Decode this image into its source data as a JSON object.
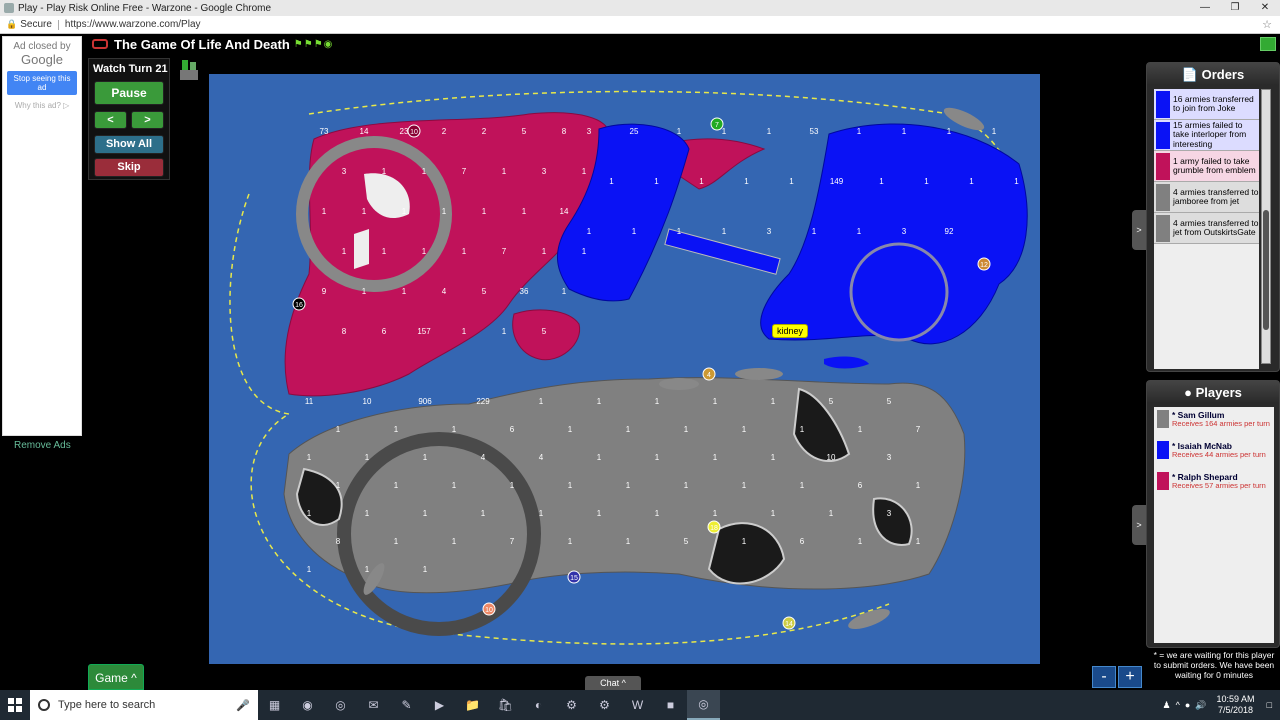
{
  "browser": {
    "tab_title": "Play - Play Risk Online Free - Warzone - Google Chrome",
    "secure_label": "Secure",
    "url": "https://www.warzone.com/Play"
  },
  "ad": {
    "closed_by": "Ad closed by",
    "google": "Google",
    "stop_seeing": "Stop seeing this ad",
    "why": "Why this ad? ▷",
    "remove_ads": "Remove Ads"
  },
  "game": {
    "title": "The Game Of Life And Death",
    "turn_label": "Watch Turn 21",
    "pause": "Pause",
    "prev": "<",
    "next": ">",
    "show_all": "Show All",
    "skip": "Skip",
    "game_menu": "Game ^",
    "chat": "Chat ^",
    "zoom_out": "-",
    "zoom_in": "+",
    "tooltip": "kidney"
  },
  "colors": {
    "sam": "#808080",
    "isaiah": "#0a12f5",
    "ralph": "#c0125a",
    "ocean": "#3466b2"
  },
  "orders": {
    "title": "Orders",
    "items": [
      {
        "text": "16 armies transferred to join from Joke",
        "color": "#0a12f5"
      },
      {
        "text": "15 armies failed to take interloper from interesting",
        "color": "#0a12f5"
      },
      {
        "text": "1 army failed to take grumble from emblem",
        "color": "#c0125a"
      },
      {
        "text": "4 armies transferred to jamboree from jet",
        "color": "#808080"
      },
      {
        "text": "4 armies transferred to jet from OutskirtsGate",
        "color": "#808080"
      }
    ]
  },
  "players": {
    "title": "Players",
    "list": [
      {
        "name": "* Sam Gillum",
        "income": "Receives 164 armies per turn",
        "color": "#808080"
      },
      {
        "name": "* Isaiah McNab",
        "income": "Receives 44 armies per turn",
        "color": "#0a12f5"
      },
      {
        "name": "* Ralph Shepard",
        "income": "Receives 57 armies per turn",
        "color": "#c0125a"
      }
    ]
  },
  "waiting_text": "* = we are waiting for this player to submit orders.  We have been waiting for 0 minutes",
  "taskbar": {
    "search_placeholder": "Type here to search",
    "time": "10:59 AM",
    "date": "7/5/2018"
  },
  "map_labels": {
    "magenta": [
      "73",
      "14",
      "23",
      "2",
      "2",
      "5",
      "8",
      "3",
      "1",
      "1",
      "7",
      "1",
      "3",
      "1",
      "1",
      "1",
      "1",
      "1",
      "1",
      "1",
      "14",
      "1",
      "1",
      "1",
      "1",
      "7",
      "1",
      "1",
      "9",
      "1",
      "1",
      "4",
      "5",
      "36",
      "1",
      "8",
      "6",
      "157",
      "1",
      "1",
      "5"
    ],
    "blue": [
      "3",
      "25",
      "1",
      "1",
      "1",
      "53",
      "1",
      "1",
      "1",
      "1",
      "1",
      "1",
      "1",
      "1",
      "1",
      "149",
      "1",
      "1",
      "1",
      "1",
      "1",
      "1",
      "1",
      "1",
      "3",
      "1",
      "1",
      "3",
      "92"
    ],
    "gray": [
      "11",
      "10",
      "906",
      "229",
      "1",
      "1",
      "1",
      "1",
      "1",
      "5",
      "5",
      "1",
      "1",
      "1",
      "6",
      "1",
      "1",
      "1",
      "1",
      "1",
      "1",
      "7",
      "1",
      "1",
      "1",
      "4",
      "4",
      "1",
      "1",
      "1",
      "1",
      "10",
      "3",
      "1",
      "1",
      "1",
      "1",
      "1",
      "1",
      "1",
      "1",
      "1",
      "6",
      "1",
      "1",
      "1",
      "1",
      "1",
      "1",
      "1",
      "1",
      "1",
      "1",
      "1",
      "3",
      "8",
      "1",
      "1",
      "7",
      "1",
      "1",
      "5",
      "1",
      "6",
      "1",
      "1",
      "1",
      "1",
      "1"
    ],
    "bonus_markers": [
      "10",
      "7",
      "16",
      "12",
      "18",
      "15",
      "10",
      "14",
      "4"
    ]
  }
}
